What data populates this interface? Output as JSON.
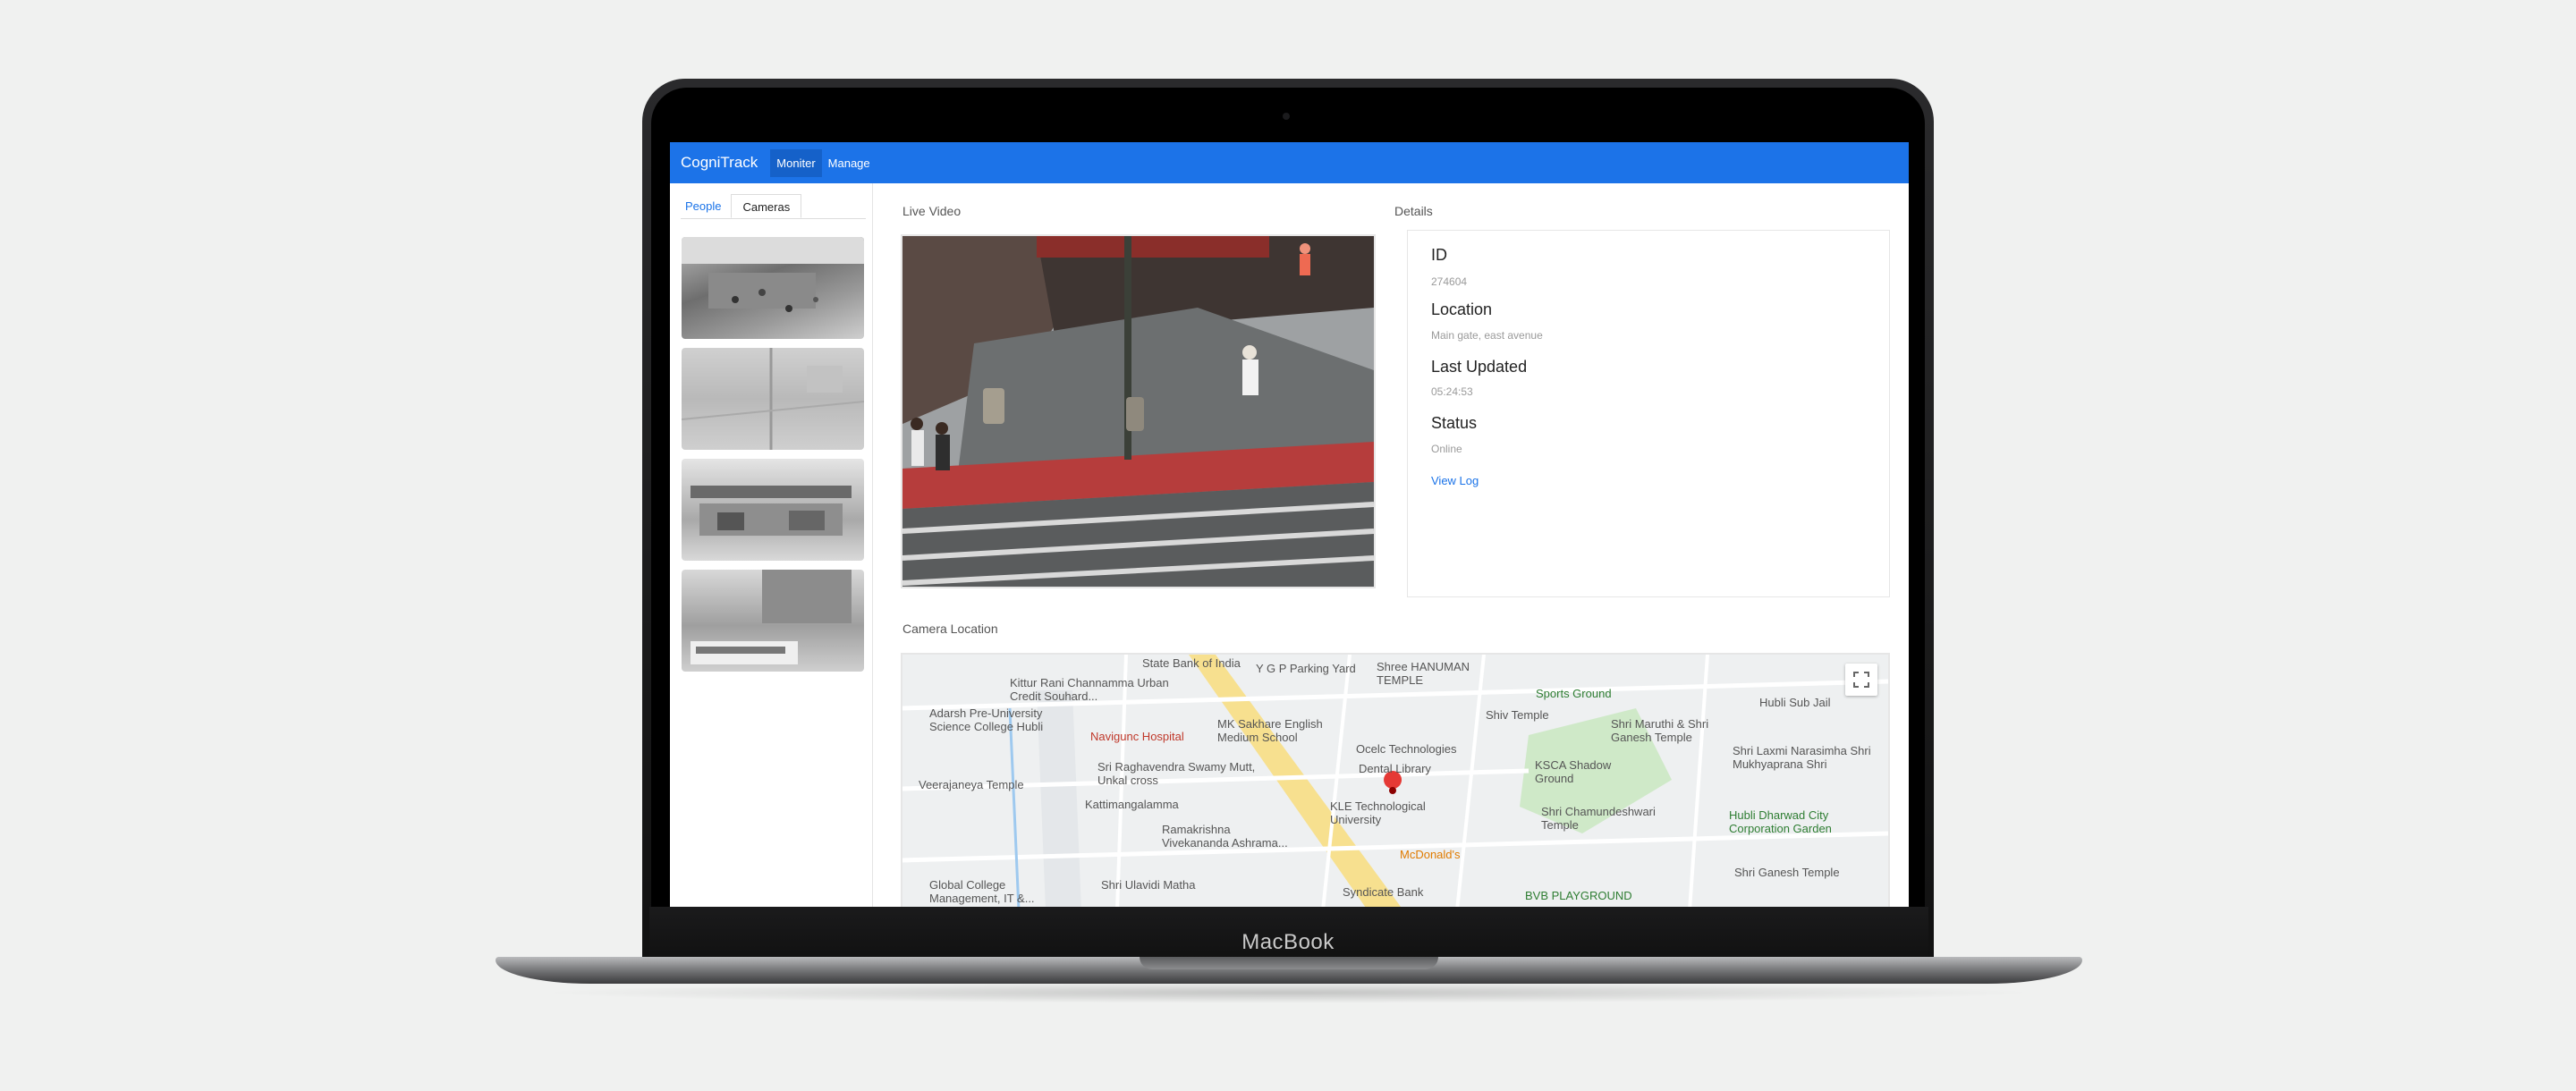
{
  "device": {
    "brand_label": "MacBook"
  },
  "app": {
    "logo": "CogniTrack",
    "nav": [
      {
        "label": "Moniter",
        "active": true
      },
      {
        "label": "Manage",
        "active": false
      }
    ]
  },
  "sidebar": {
    "tabs": [
      {
        "label": "People",
        "selected": false
      },
      {
        "label": "Cameras",
        "selected": true
      }
    ],
    "camera_count": 4
  },
  "live_video": {
    "label": "Live Video"
  },
  "details": {
    "title": "Details",
    "id_label": "ID",
    "id_value": "274604",
    "location_label": "Location",
    "location_value": "Main gate, east avenue",
    "updated_label": "Last Updated",
    "updated_value": "05:24:53",
    "status_label": "Status",
    "status_value": "Online",
    "view_log": "View Log"
  },
  "map": {
    "label": "Camera Location",
    "places": {
      "state_bank": "State Bank of India",
      "ygp": "Y G P Parking Yard",
      "hanuman": "Shree HANUMAN TEMPLE",
      "kittur": "Kittur Rani Channamma Urban Credit Souhard...",
      "adarsh": "Adarsh Pre-University Science College Hubli",
      "navigunc": "Navigunc Hospital",
      "sakhare": "MK Sakhare English Medium School",
      "sports": "Sports Ground",
      "jail": "Hubli Sub Jail",
      "shiv": "Shiv Temple",
      "maruthi": "Shri Maruthi & Shri Ganesh Temple",
      "ocelc": "Ocelc Technologies",
      "raghavendra": "Sri Raghavendra Swamy Mutt, Unkal cross",
      "dental": "Dental Library",
      "ksca": "KSCA Shadow Ground",
      "narasimha": "Shri Laxmi Narasimha Shri Mukhyaprana Shri",
      "veerajaneya": "Veerajaneya Temple",
      "kattimangalamma": "Kattimangalamma",
      "kle": "KLE Technological University",
      "chamundeshwari": "Shri Chamundeshwari Temple",
      "corporation": "Hubli Dharwad City Corporation Garden",
      "ramakrishna": "Ramakrishna Vivekananda Ashrama...",
      "mcdonalds": "McDonald's",
      "global": "Global College Management, IT &...",
      "ulavidi": "Shri Ulavidi Matha",
      "syndicate": "Syndicate Bank",
      "bvb": "BVB PLAYGROUND",
      "ganesh": "Shri Ganesh Temple"
    }
  }
}
